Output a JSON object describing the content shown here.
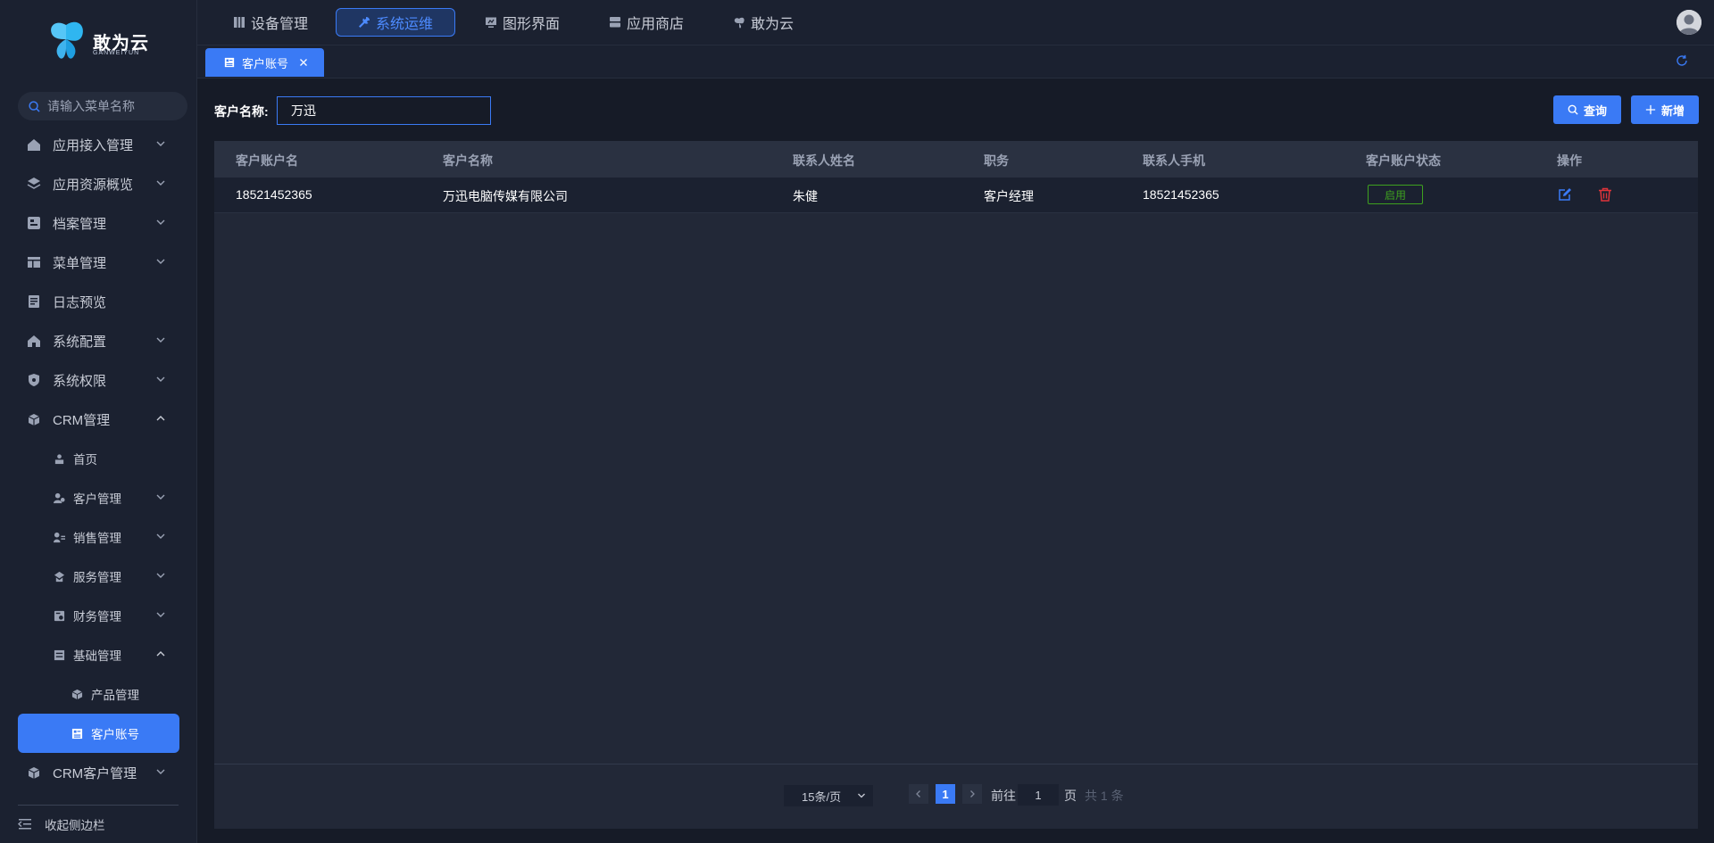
{
  "brand": {
    "name": "敢为云",
    "sub": "GANWEIYUN"
  },
  "sidebar": {
    "search_placeholder": "请输入菜单名称",
    "items": [
      {
        "label": "应用接入管理",
        "icon": "home-icon",
        "chevron": "down"
      },
      {
        "label": "应用资源概览",
        "icon": "layers-icon",
        "chevron": "down"
      },
      {
        "label": "档案管理",
        "icon": "archive-icon",
        "chevron": "down"
      },
      {
        "label": "菜单管理",
        "icon": "menu-table-icon",
        "chevron": "down"
      },
      {
        "label": "日志预览",
        "icon": "log-icon"
      },
      {
        "label": "系统配置",
        "icon": "house-icon",
        "chevron": "down"
      },
      {
        "label": "系统权限",
        "icon": "shield-icon",
        "chevron": "down"
      },
      {
        "label": "CRM管理",
        "icon": "crm-icon",
        "chevron": "up"
      },
      {
        "label": "首页",
        "icon": "home-sub-icon"
      },
      {
        "label": "客户管理",
        "icon": "customer-icon",
        "chevron": "down"
      },
      {
        "label": "销售管理",
        "icon": "sales-icon",
        "chevron": "down"
      },
      {
        "label": "服务管理",
        "icon": "service-icon",
        "chevron": "down"
      },
      {
        "label": "财务管理",
        "icon": "finance-icon",
        "chevron": "down"
      },
      {
        "label": "基础管理",
        "icon": "base-icon",
        "chevron": "up"
      },
      {
        "label": "产品管理",
        "icon": "product-icon"
      },
      {
        "label": "客户账号",
        "icon": "account-icon"
      },
      {
        "label": "CRM客户管理",
        "icon": "crm-customer-icon",
        "chevron": "down"
      }
    ],
    "collapse_label": "收起侧边栏"
  },
  "topnav": {
    "items": [
      {
        "label": "设备管理",
        "icon": "device-icon"
      },
      {
        "label": "系统运维",
        "icon": "wrench-icon",
        "active": true
      },
      {
        "label": "图形界面",
        "icon": "monitor-icon"
      },
      {
        "label": "应用商店",
        "icon": "store-icon"
      },
      {
        "label": "敢为云",
        "icon": "butterfly-icon"
      }
    ]
  },
  "tabs": {
    "current": "客户账号"
  },
  "filter": {
    "label": "客户名称:",
    "value": "万迅"
  },
  "buttons": {
    "query": "查询",
    "add": "新增"
  },
  "table": {
    "columns": [
      "客户账户名",
      "客户名称",
      "联系人姓名",
      "职务",
      "联系人手机",
      "客户账户状态",
      "操作"
    ],
    "rows": [
      {
        "account": "18521452365",
        "customer": "万迅电脑传媒有限公司",
        "contact": "朱健",
        "position": "客户经理",
        "phone": "18521452365",
        "status": "启用"
      }
    ]
  },
  "pagination": {
    "page_size": "15条/页",
    "current_page": "1",
    "goto_label": "前往",
    "goto_value": "1",
    "page_unit": "页",
    "total": "共 1 条"
  },
  "colors": {
    "accent": "#3a7af5",
    "success": "#3ea11f",
    "danger": "#e0343a",
    "bg": "#161b27"
  }
}
